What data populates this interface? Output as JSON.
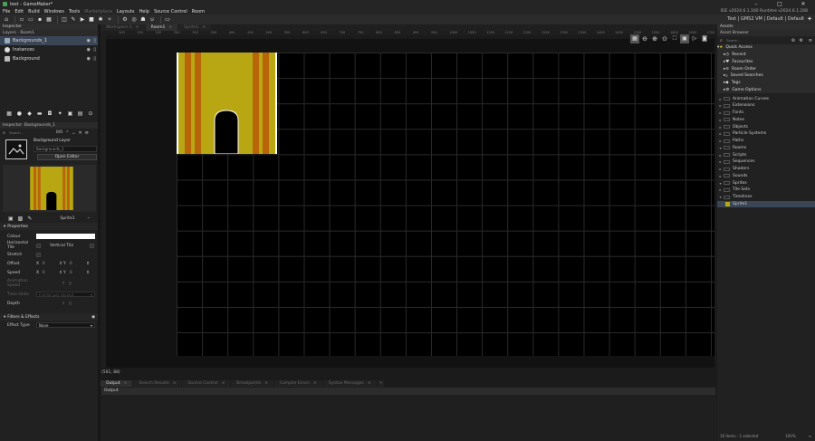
{
  "titlebar": {
    "title": "test - GameMaker*",
    "minimize": "–",
    "maximize": "□",
    "close": "✕"
  },
  "menu": {
    "items": [
      "File",
      "Edit",
      "Build",
      "Windows",
      "Tools"
    ],
    "dim_item": "Marketplace",
    "items2": [
      "Layouts",
      "Help",
      "Source Control",
      "Room"
    ],
    "version": "IDE v2024.6.1.160  Runtime v2024.6.1.208"
  },
  "toolbar": {
    "target": "Test | GMS2 VM | Default | Default"
  },
  "inspector": {
    "title": "Inspector",
    "layers_header": "Layers - Room1",
    "layers": [
      {
        "name": "Backgrounds_1",
        "selected": true
      },
      {
        "name": "Instances",
        "selected": false
      },
      {
        "name": "Background",
        "selected": false
      }
    ],
    "panel_header": "Inspector: Backgrounds_1",
    "search_placeholder": "Search...",
    "search_count": "0/0",
    "layer_label": "Background Layer",
    "layer_name": "Backgrounds_1",
    "open_editor": "Open Editor",
    "sprite_name": "Sprite1",
    "properties_header": "Properties",
    "colour_label": "Colour",
    "htile_label": "Horizontal Tile",
    "vtile_label": "Vertical Tile",
    "stretch_label": "Stretch",
    "offset_label": "Offset",
    "speed_label": "Speed",
    "x_label": "X",
    "y_label": "Y",
    "zero": "0",
    "anim_speed_label": "Animation Speed",
    "time_units_label": "Time Units",
    "time_units_value": "Frames per second",
    "depth_label": "Depth",
    "filters_header": "Filters & Effects",
    "effect_type_label": "Effect Type",
    "effect_type_value": "None"
  },
  "editor": {
    "tabs": [
      "Workspace 1",
      "Room1",
      "Sprite1"
    ],
    "active_tab": "Room1",
    "ruler_marks": [
      "100",
      "150",
      "200",
      "250",
      "300",
      "350",
      "400",
      "450",
      "500",
      "550",
      "600",
      "650",
      "700",
      "750",
      "800",
      "850",
      "900",
      "950",
      "1000",
      "1050",
      "1100",
      "1150",
      "1200",
      "1250",
      "1300",
      "1350",
      "1400",
      "1450",
      "1500",
      "1550",
      "1600",
      "1650",
      "1700"
    ],
    "coords": "(561, 88)"
  },
  "output": {
    "tabs": [
      "Output",
      "Search Results",
      "Source Control",
      "Breakpoints",
      "Compile Errors",
      "Syntax Messages"
    ],
    "active_tab": "Output",
    "header": "Output"
  },
  "assets": {
    "title": "Assets",
    "browser_label": "Asset Browser",
    "search_placeholder": "Search...",
    "quick_access": "Quick Access",
    "quick_items": [
      "Recent",
      "Favourites",
      "Room Order",
      "Saved Searches",
      "Tags",
      "Game Options"
    ],
    "folders": [
      "Animation Curves",
      "Extensions",
      "Fonts",
      "Notes",
      "Objects",
      "Particle Systems",
      "Paths",
      "Rooms",
      "Scripts",
      "Sequences",
      "Shaders",
      "Sounds",
      "Sprites",
      "Tile Sets",
      "Timelines"
    ],
    "selected_item": "Sprite1",
    "status": "16 items - 1 selected",
    "zoom": "100%"
  },
  "colors": {
    "accent": "#3a4556",
    "sprite_gold": "#b8a612",
    "sprite_brown": "#b8650a"
  }
}
